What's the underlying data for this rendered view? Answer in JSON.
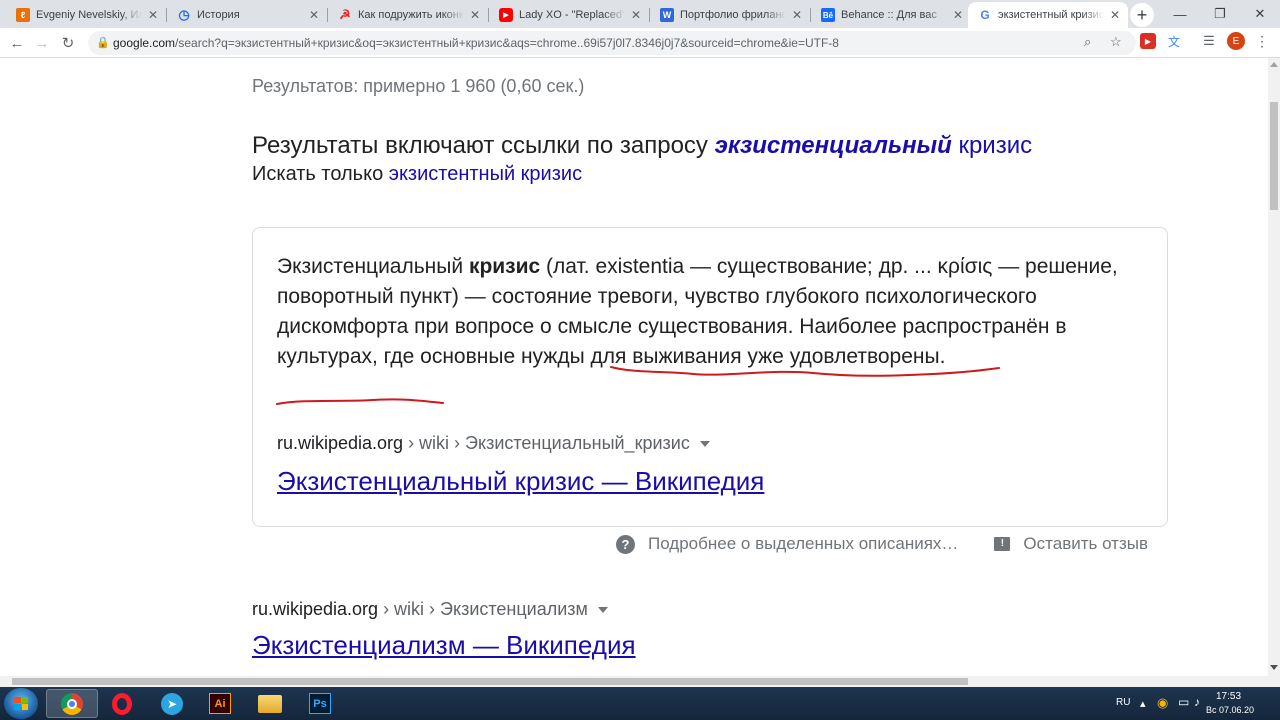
{
  "browser": {
    "tabs": [
      {
        "title": "Evgeniy Nevelskiy, Иллюс",
        "icon": "fl-icon",
        "color": "#e8710a",
        "glyph": "ℓ"
      },
      {
        "title": "История",
        "icon": "history-icon",
        "color": "#1a73e8",
        "glyph": "◷"
      },
      {
        "title": "Как подружить иконки. Тв",
        "icon": "hammer-sickle-icon",
        "color": "#d93025",
        "glyph": "☭"
      },
      {
        "title": "Lady XO - \"Replaced\" - Yo",
        "icon": "youtube-icon",
        "color": "#ff0000",
        "glyph": "▶"
      },
      {
        "title": "Портфолио фрилансера",
        "icon": "w-icon",
        "color": "#3367d6",
        "glyph": "W"
      },
      {
        "title": "Behance :: Для вас",
        "icon": "behance-icon",
        "color": "#1769ff",
        "glyph": "Bē"
      },
      {
        "title": "экзистентный кризис - П",
        "icon": "google-icon",
        "color": "#4285f4",
        "glyph": "G"
      }
    ],
    "url_host": "google.com",
    "url_rest": "/search?q=экзистентный+кризис&oq=экзистентный+кризис&aqs=chrome..69i57j0l7.8346j0j7&sourceid=chrome&ie=UTF-8",
    "profile_initial": "E"
  },
  "search": {
    "results_count": "Результатов: примерно 1 960 (0,60 сек.)",
    "spell_prefix": "Результаты включают ссылки по запросу ",
    "spell_corrected_em": "экзистенциальный",
    "spell_corrected_rest": " кризис",
    "spell_only_prefix": "Искать только ",
    "spell_only_query": "экзистентный кризис"
  },
  "featured": {
    "text_1": "Экзистенциальный ",
    "text_bold": "кризис",
    "text_2": " (лат. existentia — существование; др. ... κρίσις — решение, поворотный пункт) — состояние тревоги, чувство глубокого психологического дискомфорта при вопросе о смысле существования. Наиболее распространён в культурах, где основные нужды для выживания уже удовлетворены.",
    "cite_host": "ru.wikipedia.org",
    "cite_path": " › wiki › Экзистенциальный_кризис",
    "title": "Экзистенциальный кризис — Википедия",
    "underline_color": "#d01919"
  },
  "feedback": {
    "about": "Подробнее о выделенных описаниях…",
    "leave": "Оставить отзыв"
  },
  "result2": {
    "cite_host": "ru.wikipedia.org",
    "cite_path": " › wiki › Экзистенциализм",
    "title": "Экзистенциализм — Википедия"
  },
  "taskbar": {
    "lang": "RU",
    "time": "17:53",
    "date": "Вс 07.06.20",
    "apps": [
      {
        "name": "chrome",
        "active": true
      },
      {
        "name": "opera",
        "active": false
      },
      {
        "name": "telegram",
        "active": false
      },
      {
        "name": "illustrator",
        "active": false
      },
      {
        "name": "explorer",
        "active": false
      },
      {
        "name": "photoshop",
        "active": false
      }
    ]
  }
}
